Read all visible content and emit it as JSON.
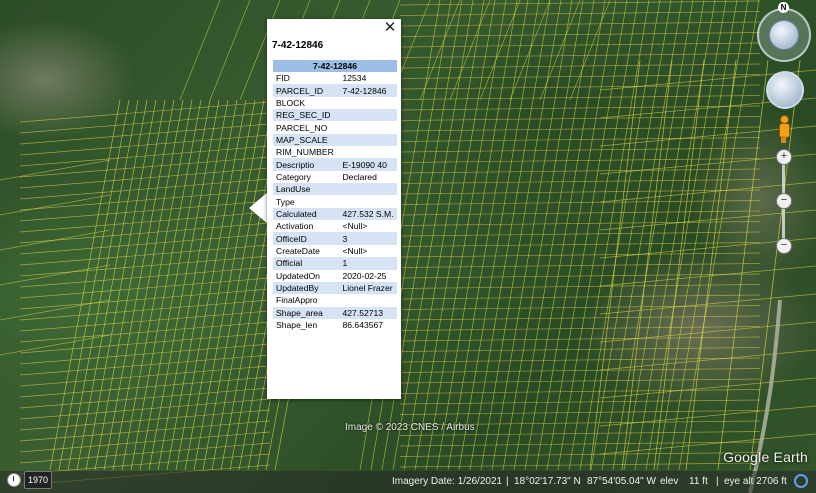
{
  "popup": {
    "title": "7-42-12846",
    "table_header": "7-42-12846",
    "rows": [
      {
        "field": "FID",
        "value": "12534"
      },
      {
        "field": "PARCEL_ID",
        "value": "7-42-12846"
      },
      {
        "field": "BLOCK",
        "value": ""
      },
      {
        "field": "REG_SEC_ID",
        "value": ""
      },
      {
        "field": "PARCEL_NO",
        "value": ""
      },
      {
        "field": "MAP_SCALE",
        "value": ""
      },
      {
        "field": "RIM_NUMBER",
        "value": ""
      },
      {
        "field": "Descriptio",
        "value": "E-19090 40"
      },
      {
        "field": "Category",
        "value": "Declared"
      },
      {
        "field": "LandUse",
        "value": ""
      },
      {
        "field": "Type",
        "value": ""
      },
      {
        "field": "Calculated",
        "value": "427.532 S.M."
      },
      {
        "field": "Activation",
        "value": "<Null>"
      },
      {
        "field": "OfficeID",
        "value": "3"
      },
      {
        "field": "CreateDate",
        "value": "<Null>"
      },
      {
        "field": "Official",
        "value": "1"
      },
      {
        "field": "UpdatedOn",
        "value": "2020-02-25"
      },
      {
        "field": "UpdatedBy",
        "value": "Lionel Frazer"
      },
      {
        "field": "FinalAppro",
        "value": ""
      },
      {
        "field": "Shape_area",
        "value": "427.52713"
      },
      {
        "field": "Shape_len",
        "value": "86.643567"
      }
    ],
    "close_icon": "close-icon"
  },
  "map": {
    "attribution": "Image © 2023 CNES / Airbus",
    "brand": "Google Earth",
    "parcel_line_color": "#e8e04a"
  },
  "status": {
    "historical_year": "1970",
    "imagery_date": "Imagery Date: 1/26/2021",
    "latitude": "18°02'17.73\" N",
    "longitude": "87°54'05.04\" W",
    "elev_label": "elev",
    "elev_value": "11 ft",
    "eye_alt": "eye alt  2706 ft"
  },
  "nav": {
    "north_label": "N",
    "zoom_in": "+",
    "zoom_out": "−",
    "zoom_mid": "−"
  }
}
